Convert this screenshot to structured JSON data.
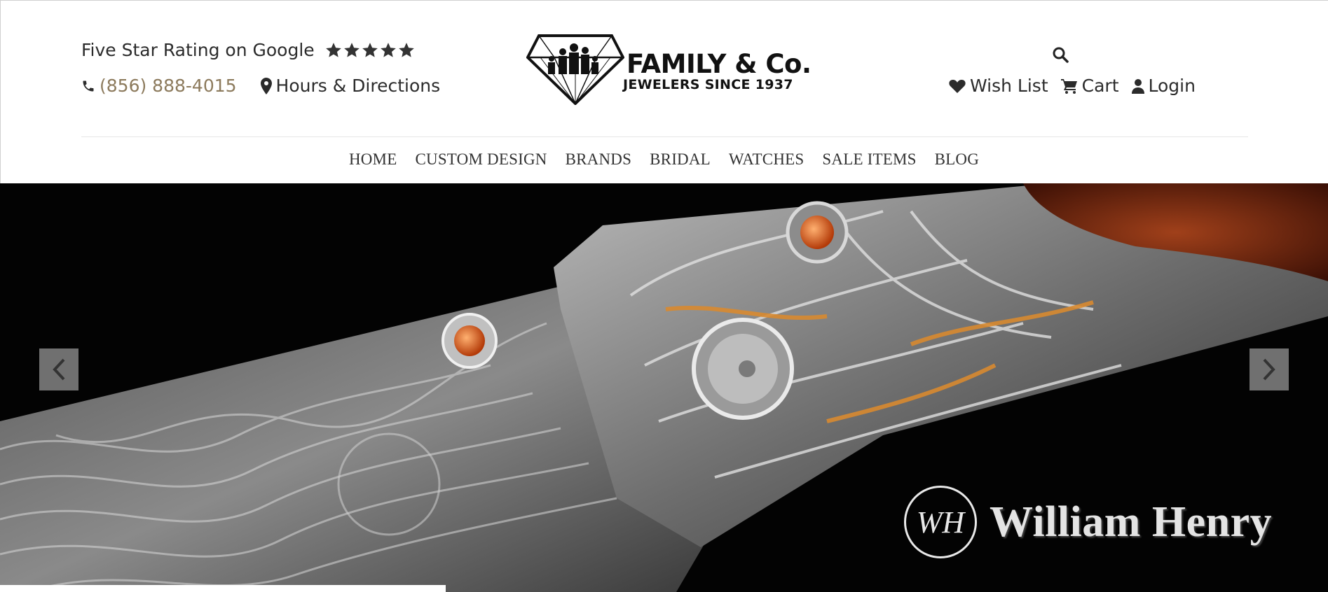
{
  "header": {
    "rating_text": "Five Star Rating on Google",
    "stars": 5,
    "phone": "(856) 888-4015",
    "hours_label": "Hours & Directions",
    "logo": {
      "title": "FAMILY & Co.",
      "subtitle": "JEWELERS SINCE 1937"
    },
    "account": {
      "wishlist": "Wish List",
      "cart": "Cart",
      "login": "Login"
    },
    "colors": {
      "phone": "#8c7a5c",
      "text": "#2b2b2b"
    }
  },
  "nav": {
    "items": [
      "HOME",
      "CUSTOM DESIGN",
      "BRANDS",
      "BRIDAL",
      "WATCHES",
      "SALE ITEMS",
      "BLOG"
    ]
  },
  "hero": {
    "brand_monogram": "WH",
    "brand_name": "William Henry",
    "prev_icon": "chevron-left-icon",
    "next_icon": "chevron-right-icon"
  }
}
